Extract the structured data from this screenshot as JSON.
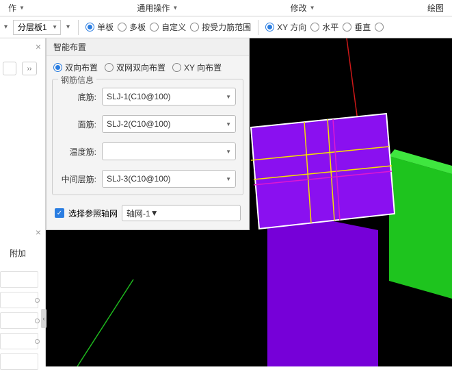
{
  "tabs": {
    "op": "作",
    "general": "通用操作",
    "modify": "修改",
    "draw": "绘图"
  },
  "toolbar": {
    "layer": "分层板1",
    "board_single": "单板",
    "board_multi": "多板",
    "board_custom": "自定义",
    "board_force": "按受力筋范围",
    "dir_xy": "XY 方向",
    "dir_h": "水平",
    "dir_v": "垂直"
  },
  "panel": {
    "title": "智能布置",
    "layout_bi": "双向布置",
    "layout_dbl": "双网双向布置",
    "layout_xy": "XY 向布置",
    "legend": "钢筋信息",
    "bottom_label": "底筋:",
    "bottom_val": "SLJ-1(C10@100)",
    "top_label": "面筋:",
    "top_val": "SLJ-2(C10@100)",
    "temp_label": "温度筋:",
    "temp_val": "",
    "mid_label": "中间层筋:",
    "mid_val": "SLJ-3(C10@100)",
    "axis_label": "选择参照轴网",
    "axis_val": "轴网-1"
  },
  "left": {
    "append": "附加"
  }
}
